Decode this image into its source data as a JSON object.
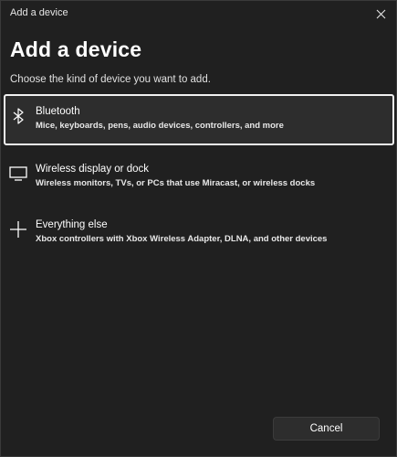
{
  "window": {
    "title": "Add a device",
    "close_icon": "close-icon"
  },
  "header": {
    "heading": "Add a device",
    "subheading": "Choose the kind of device you want to add."
  },
  "options": [
    {
      "icon": "bluetooth-icon",
      "title": "Bluetooth",
      "description": "Mice, keyboards, pens, audio devices, controllers, and more",
      "selected": true
    },
    {
      "icon": "monitor-icon",
      "title": "Wireless display or dock",
      "description": "Wireless monitors, TVs, or PCs that use Miracast, or wireless docks",
      "selected": false
    },
    {
      "icon": "plus-icon",
      "title": "Everything else",
      "description": "Xbox controllers with Xbox Wireless Adapter, DLNA, and other devices",
      "selected": false
    }
  ],
  "footer": {
    "cancel_label": "Cancel"
  },
  "colors": {
    "background": "#202020",
    "selected_background": "#2d2d2d",
    "selected_border": "#f0f0f0",
    "text": "#ffffff"
  }
}
